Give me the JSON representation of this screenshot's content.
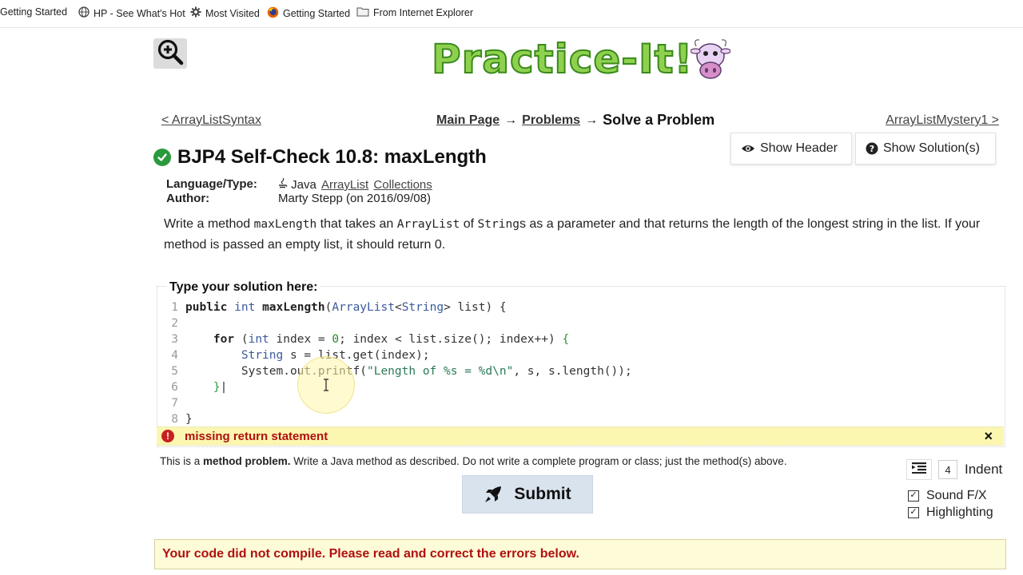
{
  "bookmarks": [
    {
      "label": "Getting Started",
      "icon": "page-icon"
    },
    {
      "label": "HP - See What's Hot",
      "icon": "globe-icon"
    },
    {
      "label": "Most Visited",
      "icon": "gear-icon"
    },
    {
      "label": "Getting Started",
      "icon": "firefox-icon"
    },
    {
      "label": "From Internet Explorer",
      "icon": "folder-icon"
    }
  ],
  "logo": {
    "text": "Practice-It!"
  },
  "nav": {
    "prev": "< ArrayListSyntax",
    "next": "ArrayListMystery1 >",
    "main": "Main Page",
    "arrow": "→",
    "problems": "Problems",
    "current": "Solve a Problem"
  },
  "problem": {
    "title": "BJP4 Self-Check 10.8: maxLength",
    "language_label": "Language/Type:",
    "language": "Java",
    "tags": [
      "ArrayList",
      "Collections"
    ],
    "author_label": "Author:",
    "author": "Marty Stepp (on 2016/09/08)",
    "desc": {
      "p1": "Write a method ",
      "c1": "maxLength",
      "p2": " that takes an ",
      "c2": "ArrayList",
      "p3": " of ",
      "c3": "String",
      "p4": "s as a parameter and that returns the length of the longest string in the list. If your method is passed an empty list, it should return 0."
    }
  },
  "buttons": {
    "show_header": "Show Header",
    "show_solution": "Show Solution(s)",
    "submit": "Submit"
  },
  "editor": {
    "label": "Type your solution here:",
    "line_numbers": [
      "1",
      "2",
      "3",
      "4",
      "5",
      "6",
      "7",
      "8"
    ]
  },
  "error": {
    "message": "missing return statement",
    "close": "×",
    "compile": "Your code did not compile. Please read and correct the errors below."
  },
  "hint": {
    "pre": "This is a ",
    "bold": "method problem.",
    "post": " Write a Java method as described. Do not write a complete program or class; just the method(s) above."
  },
  "indent": {
    "value": "4",
    "label": "Indent"
  },
  "options": {
    "sound": "Sound F/X",
    "highlighting": "Highlighting",
    "check": "☑"
  },
  "colors": {
    "accent_green": "#2a9a3c",
    "error_red": "#b01010",
    "error_bg": "#fbf7b0"
  }
}
